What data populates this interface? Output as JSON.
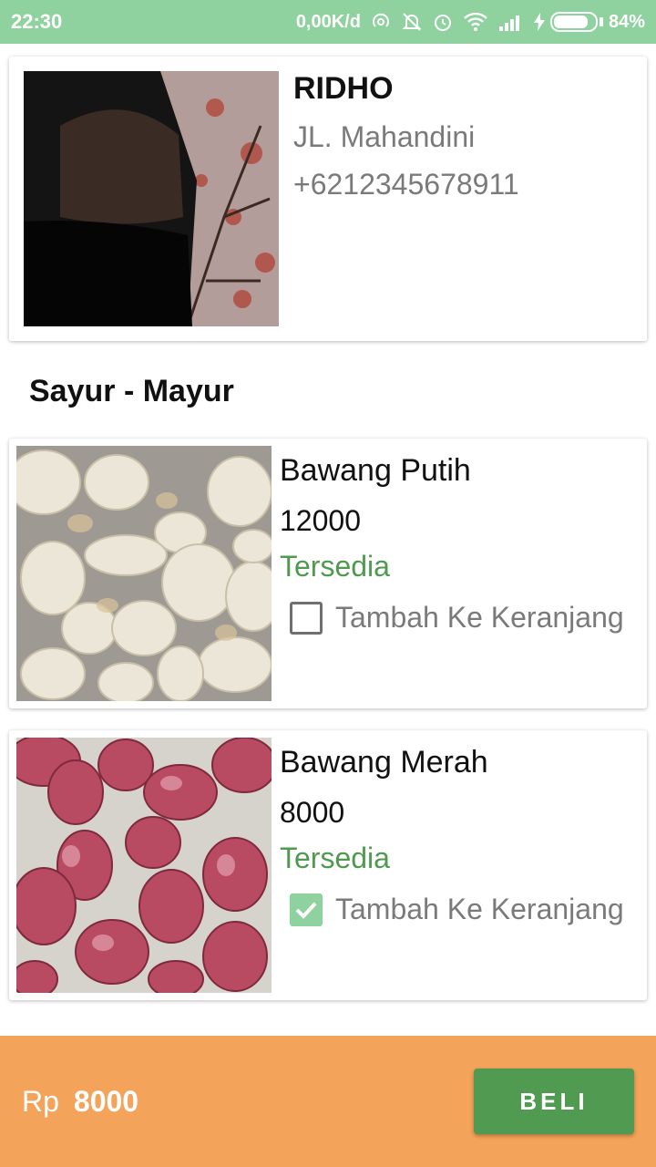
{
  "status_bar": {
    "time": "22:30",
    "network_speed": "0,00K/d",
    "battery_percent": "84%",
    "battery_level": 0.84,
    "icons": [
      "hotspot-icon",
      "bell-off-icon",
      "alarm-icon",
      "wifi-icon",
      "signal-icon",
      "charging-icon",
      "battery-icon"
    ]
  },
  "profile": {
    "name": "RIDHO",
    "address": "JL. Mahandini",
    "phone": "+6212345678911"
  },
  "section": {
    "title": "Sayur - Mayur"
  },
  "products": [
    {
      "name": "Bawang Putih",
      "price": "12000",
      "status": "Tersedia",
      "cart_label": "Tambah Ke Keranjang",
      "checked": false
    },
    {
      "name": "Bawang Merah",
      "price": "8000",
      "status": "Tersedia",
      "cart_label": "Tambah Ke Keranjang",
      "checked": true
    }
  ],
  "footer": {
    "currency": "Rp",
    "total": "8000",
    "buy_label": "BELI"
  },
  "colors": {
    "status_bar": "#8fd19f",
    "accent_green": "#519a51",
    "available_text": "#4f9a4f",
    "footer_bg": "#f3a35a",
    "checkbox_checked": "#8fd19f"
  }
}
